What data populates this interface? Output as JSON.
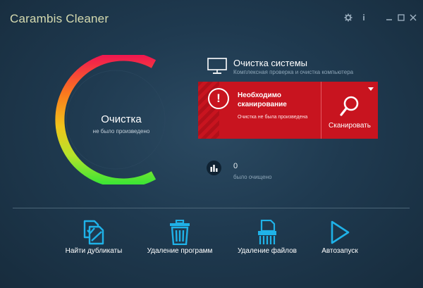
{
  "app": {
    "title": "Carambis Cleaner"
  },
  "titlebar": {
    "icons": [
      "gear-icon",
      "info-icon",
      "minimize-icon",
      "maximize-icon",
      "close-icon"
    ],
    "info_glyph": "i"
  },
  "ring": {
    "title": "Очистка",
    "subtitle": "не было произведено",
    "colors": [
      "#f0194f",
      "#fb7b1d",
      "#f2c41b",
      "#b6e32a",
      "#3ee535"
    ]
  },
  "system": {
    "title": "Очистка системы",
    "subtitle": "Комплексная проверка и очистка компьютера",
    "icon": "monitor-icon"
  },
  "alert": {
    "icon_glyph": "!",
    "title": "Необходимо сканирование",
    "subtitle": "Очистка не была произведена",
    "scan_label": "Сканировать",
    "color": "#c8141f"
  },
  "stats": {
    "value": "0",
    "label": "было очищено",
    "icon": "bar-chart-icon"
  },
  "tools": [
    {
      "label": "Найти дубликаты",
      "icon": "duplicates-icon"
    },
    {
      "label": "Удаление программ",
      "icon": "trash-icon"
    },
    {
      "label": "Удаление файлов",
      "icon": "shredder-icon"
    },
    {
      "label": "Автозапуск",
      "icon": "play-icon"
    }
  ],
  "accent": "#1fb2e8"
}
